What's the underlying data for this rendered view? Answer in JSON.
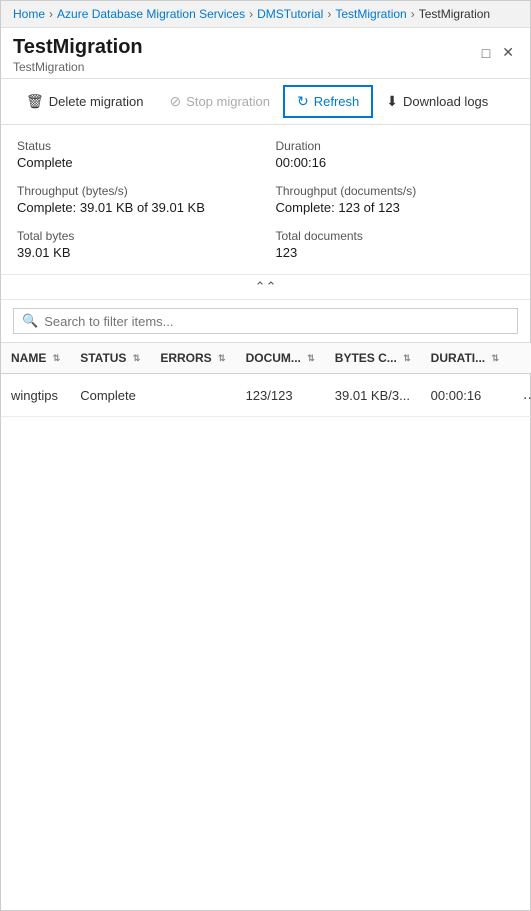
{
  "breadcrumb": {
    "items": [
      {
        "label": "Home",
        "href": "#"
      },
      {
        "label": "Azure Database Migration Services",
        "href": "#"
      },
      {
        "label": "DMSTutorial",
        "href": "#"
      },
      {
        "label": "TestMigration",
        "href": "#"
      },
      {
        "label": "TestMigration",
        "current": true
      }
    ]
  },
  "header": {
    "title": "TestMigration",
    "subtitle": "TestMigration",
    "window_btn_maximize": "□",
    "window_btn_close": "✕"
  },
  "toolbar": {
    "delete_label": "Delete migration",
    "stop_label": "Stop migration",
    "refresh_label": "Refresh",
    "download_label": "Download logs"
  },
  "stats": [
    {
      "label": "Status",
      "value": "Complete"
    },
    {
      "label": "Duration",
      "value": "00:00:16"
    },
    {
      "label": "Throughput (bytes/s)",
      "value": "Complete: 39.01 KB of 39.01 KB"
    },
    {
      "label": "Throughput (documents/s)",
      "value": "Complete: 123 of 123"
    },
    {
      "label": "Total bytes",
      "value": "39.01 KB"
    },
    {
      "label": "Total documents",
      "value": "123"
    }
  ],
  "search": {
    "placeholder": "Search to filter items..."
  },
  "table": {
    "columns": [
      {
        "key": "name",
        "label": "NAME"
      },
      {
        "key": "status",
        "label": "STATUS"
      },
      {
        "key": "errors",
        "label": "ERRORS"
      },
      {
        "key": "documents",
        "label": "DOCUM..."
      },
      {
        "key": "bytes",
        "label": "BYTES C..."
      },
      {
        "key": "duration",
        "label": "DURATI..."
      },
      {
        "key": "actions",
        "label": ""
      }
    ],
    "rows": [
      {
        "name": "wingtips",
        "status": "Complete",
        "errors": "",
        "documents": "123/123",
        "bytes": "39.01 KB/3...",
        "duration": "00:00:16",
        "actions": "..."
      }
    ]
  }
}
